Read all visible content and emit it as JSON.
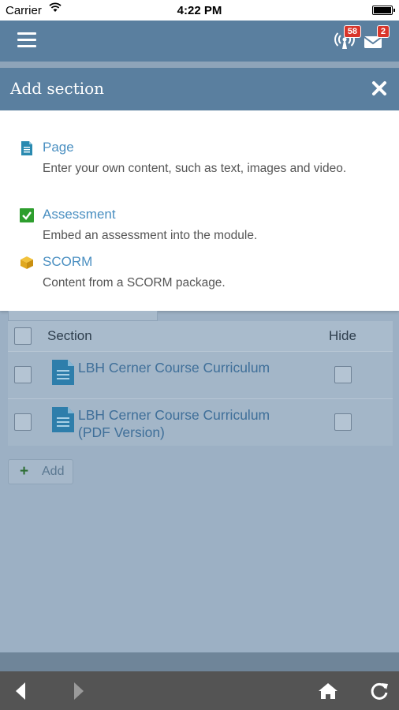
{
  "status_bar": {
    "carrier": "Carrier",
    "time": "4:22 PM"
  },
  "header": {
    "notifications_badge": "58",
    "messages_badge": "2"
  },
  "modal": {
    "title": "Add section",
    "options": [
      {
        "title": "Page",
        "description": "Enter your own content, such as text, images and video.",
        "icon": "page-icon",
        "icon_color": "#2a8ab0"
      },
      {
        "title": "Assessment",
        "description": "Embed an assessment into the module.",
        "icon": "checkbox-icon",
        "icon_color": "#2e9e2e"
      },
      {
        "title": "SCORM",
        "description": "Content from a SCORM package.",
        "icon": "package-icon",
        "icon_color": "#e0a820"
      }
    ]
  },
  "table": {
    "headers": {
      "section": "Section",
      "hide": "Hide"
    },
    "rows": [
      {
        "title": "LBH Cerner Course Curriculum"
      },
      {
        "title": "LBH Cerner Course Curriculum (PDF Version)"
      }
    ]
  },
  "add_button": {
    "label": "Add"
  },
  "colors": {
    "header": "#5a7f9f",
    "overlay": "#9cb0c4",
    "link": "#4a8fc1",
    "bottom_bar": "#545454"
  }
}
